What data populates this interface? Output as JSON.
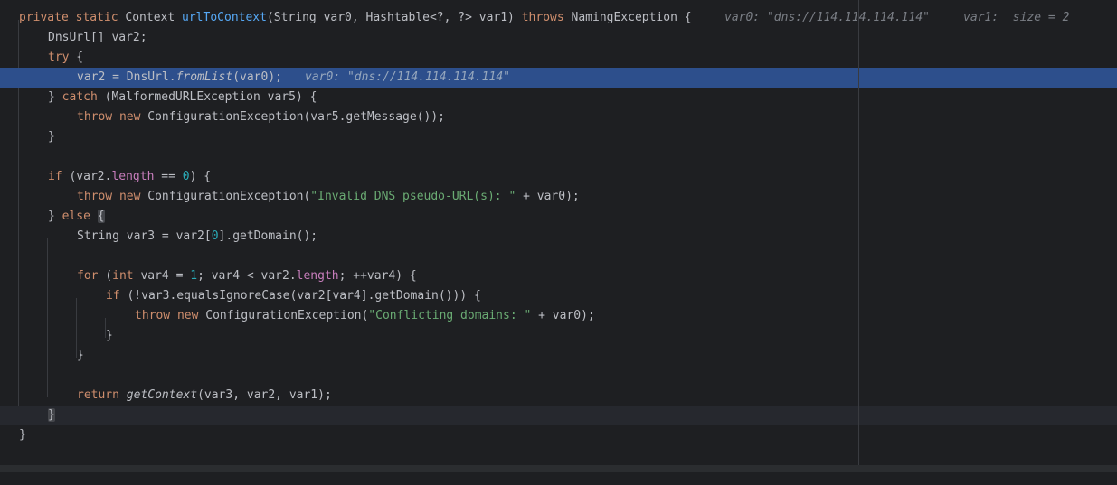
{
  "lines": {
    "l1": {
      "mod": "private static",
      "type": "Context",
      "name": "urlToContext",
      "params": "(String var0, Hashtable<?, ?> var1)",
      "throws": "throws",
      "exc": "NamingException {",
      "hint1": "var0: \"dns://114.114.114.114\"",
      "hint2": "var1:  size = 2"
    },
    "l2": {
      "text": "DnsUrl[] var2;"
    },
    "l3": {
      "kw": "try",
      "rest": " {"
    },
    "l4": {
      "a": "var2 = DnsUrl.",
      "method": "fromList",
      "b": "(var0);",
      "hint": "var0: \"dns://114.114.114.114\""
    },
    "l5": {
      "a": "} ",
      "kw": "catch",
      "b": " (MalformedURLException var5) {"
    },
    "l6": {
      "kw": "throw new",
      "b": " ConfigurationException(var5.getMessage());"
    },
    "l7": {
      "text": "}"
    },
    "l9": {
      "kw": "if",
      "a": " (var2.",
      "field": "length",
      "b": " == ",
      "num": "0",
      "c": ") {"
    },
    "l10": {
      "kw": "throw new",
      "a": " ConfigurationException(",
      "str": "\"Invalid DNS pseudo-URL(s): \"",
      "b": " + var0);"
    },
    "l11": {
      "a": "} ",
      "kw": "else",
      "b": " ",
      "brace": "{"
    },
    "l12": {
      "a": "String var3 = var2[",
      "num": "0",
      "b": "].getDomain();"
    },
    "l14": {
      "kw": "for",
      "a": " (",
      "kw2": "int",
      "b": " var4 = ",
      "num": "1",
      "c": "; var4 < var2.",
      "field": "length",
      "d": "; ++var4) {"
    },
    "l15": {
      "kw": "if",
      "a": " (!var3.equalsIgnoreCase(var2[var4].getDomain())) {"
    },
    "l16": {
      "kw": "throw new",
      "a": " ConfigurationException(",
      "str": "\"Conflicting domains: \"",
      "b": " + var0);"
    },
    "l17": {
      "text": "}"
    },
    "l18": {
      "text": "}"
    },
    "l20": {
      "kw": "return",
      "a": " ",
      "method": "getContext",
      "b": "(var3, var2, var1);"
    },
    "l21": {
      "brace": "}"
    },
    "l22": {
      "text": "}"
    }
  },
  "colors": {
    "background": "#1e1f22",
    "execution_line": "#2d4f8c",
    "keyword": "#cf8e6d",
    "function_decl": "#56a8f5",
    "string": "#6aab73",
    "number": "#2aacb8",
    "field": "#c77dbb",
    "inline_hint": "#7a7e85"
  }
}
